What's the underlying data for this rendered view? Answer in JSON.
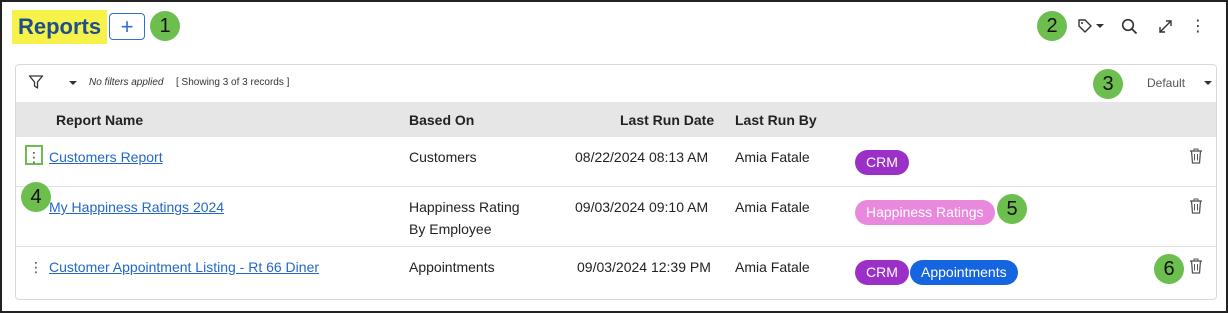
{
  "page": {
    "title": "Reports"
  },
  "toolbar": {
    "add_label": "+"
  },
  "callouts": [
    "1",
    "2",
    "3",
    "4",
    "5",
    "6"
  ],
  "filterbar": {
    "filter_status": "No filters applied",
    "record_count": "[ Showing 3 of 3 records ]",
    "view_selected": "Default"
  },
  "table": {
    "headers": {
      "report_name": "Report Name",
      "based_on": "Based On",
      "last_run_date": "Last Run Date",
      "last_run_by": "Last Run By"
    },
    "rows": [
      {
        "name": "Customers Report",
        "based_on_line1": "Customers",
        "based_on_line2": "",
        "last_run_date": "08/22/2024 08:13 AM",
        "last_run_by": "Amia Fatale",
        "tags": [
          {
            "label": "CRM",
            "color": "#9b30c9"
          }
        ]
      },
      {
        "name": "My Happiness Ratings 2024",
        "based_on_line1": "Happiness Rating",
        "based_on_line2": "By Employee",
        "last_run_date": "09/03/2024 09:10 AM",
        "last_run_by": "Amia Fatale",
        "tags": [
          {
            "label": "Happiness Ratings",
            "color": "#e889dd"
          }
        ]
      },
      {
        "name": "Customer Appointment Listing - Rt 66 Diner",
        "based_on_line1": "Appointments",
        "based_on_line2": "",
        "last_run_date": "09/03/2024 12:39 PM",
        "last_run_by": "Amia Fatale",
        "tags": [
          {
            "label": "CRM",
            "color": "#9b30c9"
          },
          {
            "label": "Appointments",
            "color": "#1565e0"
          }
        ]
      }
    ]
  },
  "icons": {
    "row_menu": "⋮",
    "tag": "tag-icon",
    "search": "search-icon",
    "expand": "expand-icon",
    "more": "more-vertical-icon",
    "filter": "filter-icon",
    "delete": "trash-icon"
  },
  "colors": {
    "accent_blue": "#2368c9",
    "callout_green": "#6cbf4e",
    "title_highlight": "#f6f24a"
  }
}
